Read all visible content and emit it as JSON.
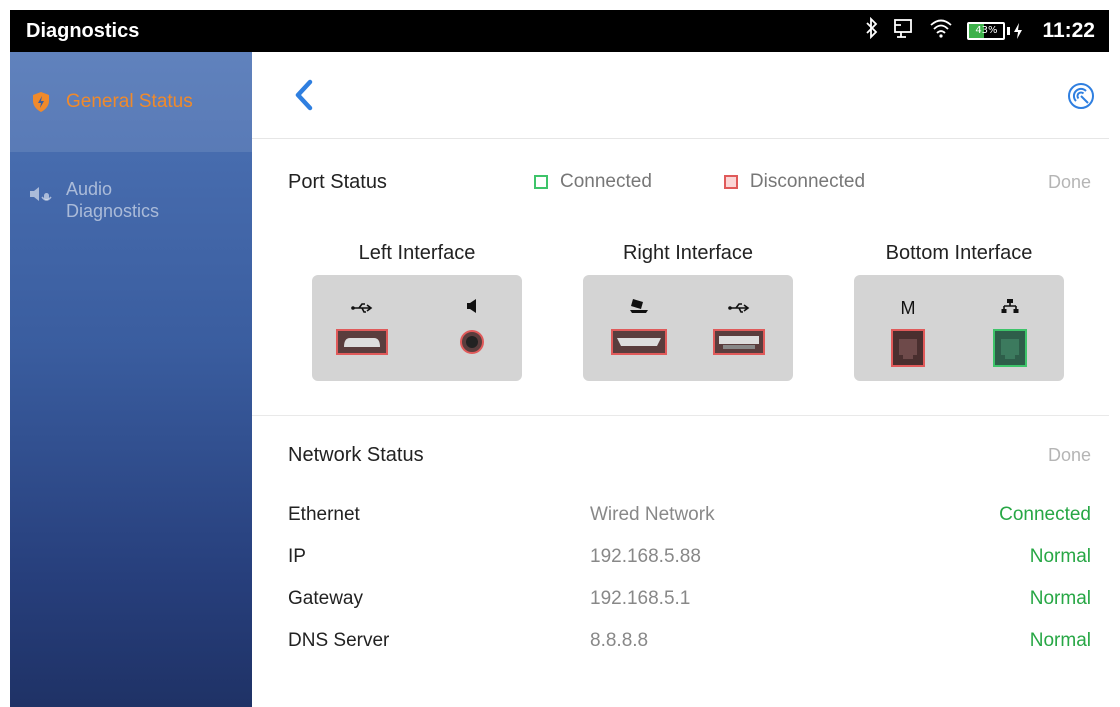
{
  "statusbar": {
    "app_title": "Diagnostics",
    "icons": [
      "bluetooth-icon",
      "cast-icon",
      "wifi-icon"
    ],
    "battery_percent": "43%",
    "battery_level": 0.43,
    "clock": "11:22"
  },
  "sidebar": {
    "items": [
      {
        "label": "General Status",
        "icon": "shield-bolt-icon",
        "active": true
      },
      {
        "label": "Audio\nDiagnostics",
        "label_line1": "Audio",
        "label_line2": "Diagnostics",
        "icon": "speaker-mic-icon",
        "active": false
      }
    ]
  },
  "colors": {
    "accent": "#f08a2b",
    "back_arrow": "#2f7fe0",
    "connected": "#27a745",
    "legend_connected": "#3ec46a",
    "legend_disconnected": "#e05a5a"
  },
  "port_status": {
    "title": "Port Status",
    "legend_connected": "Connected",
    "legend_disconnected": "Disconnected",
    "done": "Done",
    "groups": [
      {
        "name": "Left Interface",
        "ports": [
          {
            "symbol": "usb-icon",
            "type": "micro-usb",
            "state": "disconnected"
          },
          {
            "symbol": "speaker-icon",
            "type": "audio-jack",
            "state": "disconnected"
          }
        ]
      },
      {
        "name": "Right Interface",
        "ports": [
          {
            "symbol": "laptop-icon",
            "type": "hdmi",
            "state": "disconnected"
          },
          {
            "symbol": "usb-icon",
            "type": "usb-a",
            "state": "disconnected"
          }
        ]
      },
      {
        "name": "Bottom Interface",
        "ports": [
          {
            "symbol": "M",
            "type": "rj45",
            "state": "disconnected"
          },
          {
            "symbol": "network-icon",
            "type": "rj45",
            "state": "connected"
          }
        ]
      }
    ]
  },
  "network_status": {
    "title": "Network Status",
    "done": "Done",
    "rows": [
      {
        "key": "Ethernet",
        "value": "Wired Network",
        "status": "Connected"
      },
      {
        "key": "IP",
        "value": "192.168.5.88",
        "status": "Normal"
      },
      {
        "key": "Gateway",
        "value": "192.168.5.1",
        "status": "Normal"
      },
      {
        "key": "DNS Server",
        "value": "8.8.8.8",
        "status": "Normal"
      }
    ]
  }
}
